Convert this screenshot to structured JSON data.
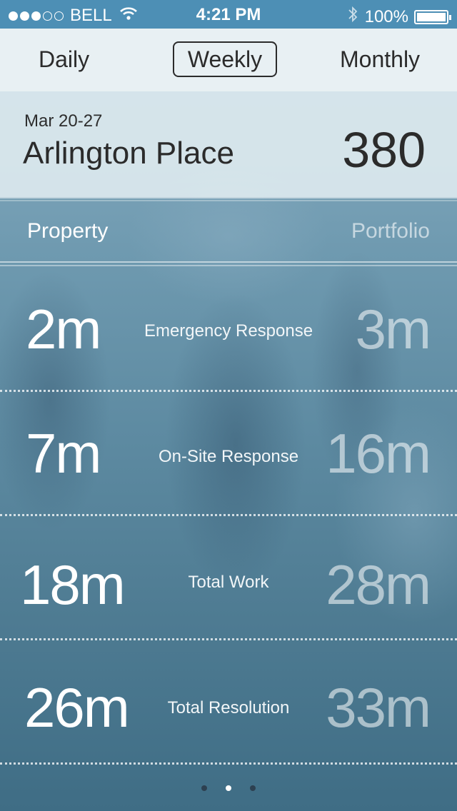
{
  "status_bar": {
    "carrier": "BELL",
    "time": "4:21 PM",
    "battery": "100%"
  },
  "segments": {
    "daily": "Daily",
    "weekly": "Weekly",
    "monthly": "Monthly",
    "selected": "Weekly"
  },
  "header": {
    "date_range": "Mar 20-27",
    "property_name": "Arlington Place",
    "count": "380"
  },
  "columns": {
    "property": "Property",
    "portfolio": "Portfolio"
  },
  "metrics": [
    {
      "label": "Emergency Response",
      "property": "2m",
      "portfolio": "3m"
    },
    {
      "label": "On-Site Response",
      "property": "7m",
      "portfolio": "16m"
    },
    {
      "label": "Total Work",
      "property": "18m",
      "portfolio": "28m"
    },
    {
      "label": "Total Resolution",
      "property": "26m",
      "portfolio": "33m"
    }
  ],
  "pager": {
    "pages": 3,
    "current": 2
  },
  "colors": {
    "status_bar": "#4d8fb5",
    "segment_bg": "#e8f0f3",
    "text_dark": "#2b2b2b"
  },
  "icons": [
    "signal-dots-icon",
    "wifi-icon",
    "bluetooth-icon",
    "battery-icon"
  ]
}
